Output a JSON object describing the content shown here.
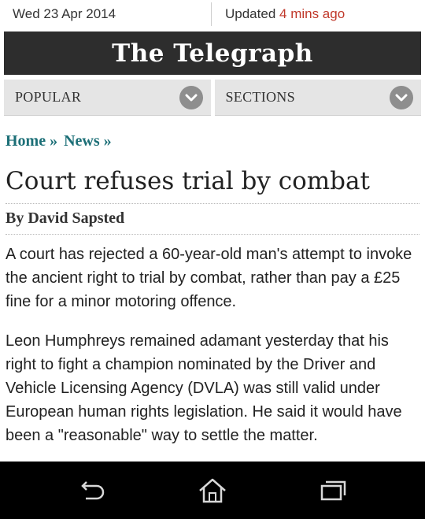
{
  "topbar": {
    "date": "Wed 23 Apr 2014",
    "updated_label": "Updated",
    "updated_ago": "4 mins ago"
  },
  "masthead": {
    "logo": "The Telegraph"
  },
  "nav": {
    "popular": "POPULAR",
    "sections": "SECTIONS"
  },
  "breadcrumb": {
    "home": "Home »",
    "news": "News »"
  },
  "article": {
    "headline": "Court refuses trial by combat",
    "byline": "By David Sapsted",
    "paragraphs": [
      "A court has rejected a 60-year-old man's attempt to invoke the ancient right to trial by combat, rather than pay a £25 fine for a minor motoring offence.",
      "Leon Humphreys remained adamant yesterday that his right to fight a champion nominated by the Driver and Vehicle Licensing Agency (DVLA) was still valid under European human rights legislation. He said it would have been a \"reasonable\" way to settle the matter."
    ]
  },
  "system_nav": {
    "icons": [
      "back-icon",
      "home-icon",
      "recent-apps-icon"
    ]
  },
  "colors": {
    "accent_link": "#1c6f77",
    "updated_red": "#c0392b",
    "masthead_bg": "#2d2d2d"
  }
}
